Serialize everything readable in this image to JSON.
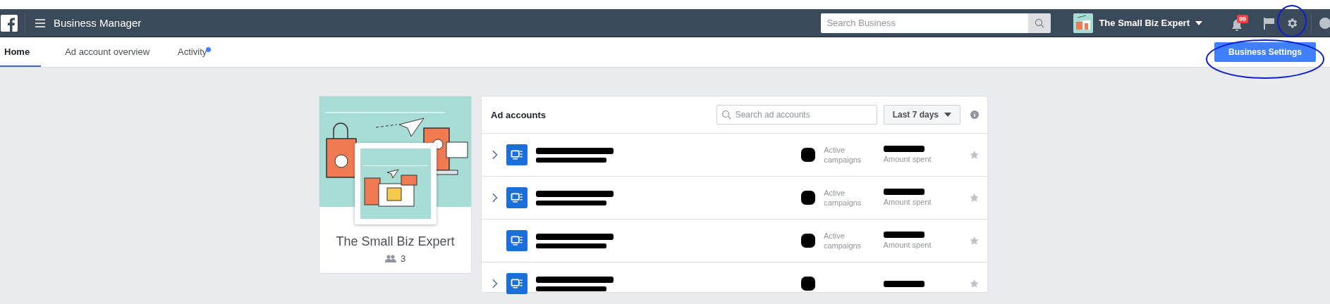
{
  "nav": {
    "title": "Business Manager",
    "search": {
      "placeholder": "Search Business"
    },
    "account": {
      "name": "The Small Biz Expert"
    },
    "notifications": {
      "count": "99"
    }
  },
  "tabs": [
    {
      "label": "Home",
      "selected": true,
      "unread": false
    },
    {
      "label": "Ad account overview",
      "selected": false,
      "unread": false
    },
    {
      "label": "Activity",
      "selected": false,
      "unread": true
    }
  ],
  "settings_button": "Business Settings",
  "business_card": {
    "name": "The Small Biz Expert",
    "people": "3"
  },
  "ad_accounts": {
    "title": "Ad accounts",
    "search": {
      "placeholder": "Search ad accounts"
    },
    "range": "Last 7 days",
    "rows": [
      {
        "expandable": true,
        "campaigns_label": "Active campaigns",
        "spent_label": "Amount spent",
        "starred": false
      },
      {
        "expandable": true,
        "campaigns_label": "Active campaigns",
        "spent_label": "Amount spent",
        "starred": false
      },
      {
        "expandable": false,
        "campaigns_label": "Active campaigns",
        "spent_label": "Amount spent",
        "starred": false
      },
      {
        "expandable": true,
        "starred": false
      }
    ]
  }
}
